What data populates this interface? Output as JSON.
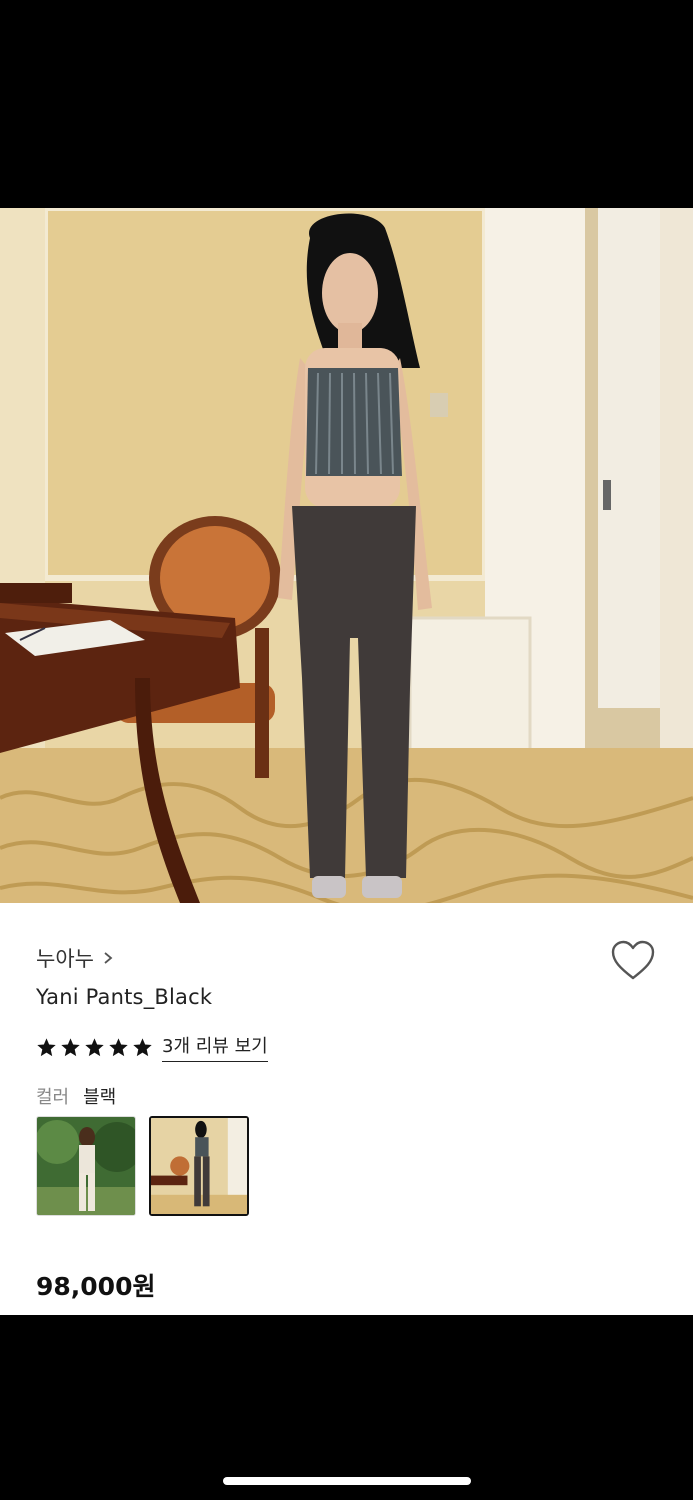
{
  "product": {
    "brand": "누아누",
    "title": "Yani Pants_Black",
    "rating_stars": 5,
    "review_link": "3개 리뷰 보기",
    "color_label": "컬러",
    "color_value": "블랙",
    "price": "98,000원",
    "selected_swatch_index": 1
  },
  "icons": {
    "brand_chevron": "chevron-right-icon",
    "wishlist": "heart-outline-icon",
    "star": "star-filled-icon"
  },
  "colors": {
    "text_primary": "#222222",
    "text_secondary": "#888888",
    "heart_stroke": "#555555",
    "star_fill": "#111111"
  }
}
